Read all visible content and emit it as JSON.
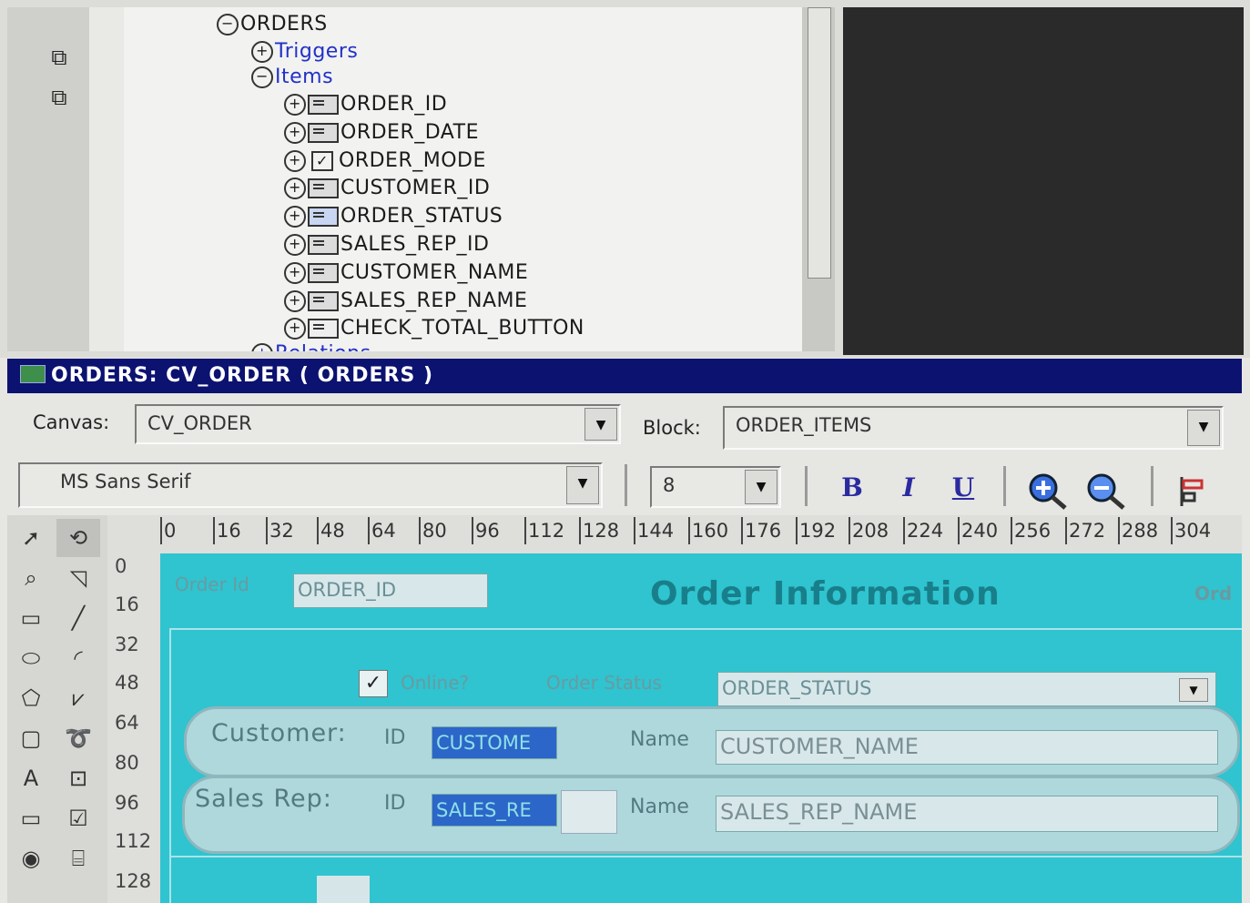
{
  "navigator": {
    "root": "ORDERS",
    "triggers": "Triggers",
    "items_label": "Items",
    "items": [
      "ORDER_ID",
      "ORDER_DATE",
      "ORDER_MODE",
      "CUSTOMER_ID",
      "ORDER_STATUS",
      "SALES_REP_ID",
      "CUSTOMER_NAME",
      "SALES_REP_NAME",
      "CHECK_TOTAL_BUTTON"
    ],
    "next_partial": "Relations"
  },
  "window": {
    "title": "ORDERS: CV_ORDER ( ORDERS )"
  },
  "toolbar": {
    "canvas_label": "Canvas:",
    "canvas_value": "CV_ORDER",
    "block_label": "Block:",
    "block_value": "ORDER_ITEMS",
    "font_value": "MS Sans Serif",
    "size_value": "8",
    "bold": "B",
    "italic": "I",
    "underline": "U"
  },
  "ruler": {
    "h": [
      "0",
      "16",
      "32",
      "48",
      "64",
      "80",
      "96",
      "112",
      "128",
      "144",
      "160",
      "176",
      "192",
      "208",
      "224",
      "240",
      "256",
      "272",
      "288",
      "304"
    ],
    "v": [
      "0",
      "16",
      "32",
      "48",
      "64",
      "80",
      "96",
      "112",
      "128"
    ]
  },
  "layout_canvas": {
    "order_id_label": "Order Id",
    "order_id_field": "ORDER_ID",
    "heading": "Order Information",
    "heading_cut": "Ord",
    "online_label": "Online?",
    "order_status_label": "Order Status",
    "order_status_field": "ORDER_STATUS",
    "customer_label": "Customer:",
    "customer_id_label": "ID",
    "customer_id_field": "CUSTOME",
    "customer_name_label": "Name",
    "customer_name_field": "CUSTOMER_NAME",
    "salesrep_label": "Sales Rep:",
    "salesrep_id_label": "ID",
    "salesrep_id_field": "SALES_RE",
    "salesrep_name_label": "Name",
    "salesrep_name_field": "SALES_REP_NAME"
  },
  "colors": {
    "title_bar": "#0b1270",
    "canvas_bg": "#2fc4cf",
    "tree_link": "#2231c8"
  }
}
